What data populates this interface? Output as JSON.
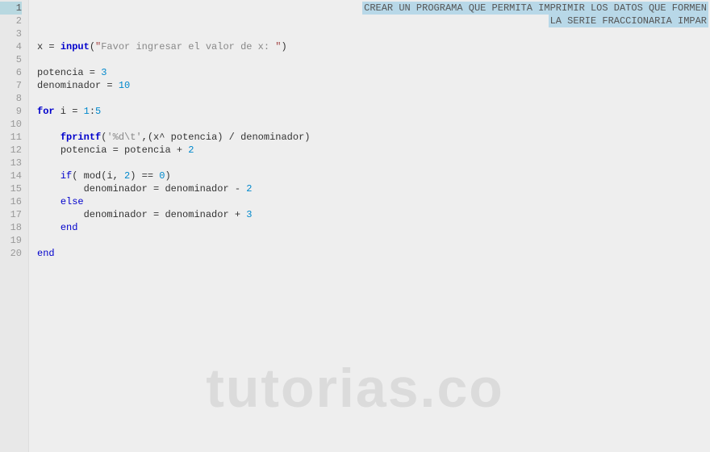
{
  "gutter": {
    "lines": [
      "1",
      "2",
      "3",
      "4",
      "5",
      "6",
      "7",
      "8",
      "9",
      "10",
      "11",
      "12",
      "13",
      "14",
      "15",
      "16",
      "17",
      "18",
      "19",
      "20"
    ],
    "highlighted": 1
  },
  "comment": {
    "line1": "CREAR UN PROGRAMA QUE PERMITA IMPRIMIR LOS DATOS QUE FORMEN",
    "line2": "LA SERIE FRACCIONARIA IMPAR"
  },
  "code": {
    "l4": {
      "var_x": "x",
      "eq": " = ",
      "input": "input",
      "open": "(",
      "q1": "\"",
      "str": "Favor ingresar el valor de x: ",
      "q2": "\"",
      "close": ")"
    },
    "l6": {
      "var": "potencia",
      "eq": " = ",
      "val": "3"
    },
    "l7": {
      "var": "denominador",
      "eq": " = ",
      "val": "10"
    },
    "l9": {
      "for": "for",
      "i": " i",
      "eq": " = ",
      "r1": "1",
      "colon": ":",
      "r2": "5"
    },
    "l11": {
      "indent": "    ",
      "fprintf": "fprintf",
      "open": "(",
      "fmt": "'%d\\t'",
      "rest": ",(x^ potencia) / denominador)"
    },
    "l12": {
      "indent": "    ",
      "lhs": "potencia",
      "eq": " = ",
      "rhs": "potencia",
      "op": " + ",
      "val": "2"
    },
    "l14": {
      "indent": "    ",
      "if": "if",
      "open": "( ",
      "mod": "mod",
      "args_open": "(",
      "arg1": "i",
      "comma": ", ",
      "arg2": "2",
      "args_close": ")",
      "eqeq": " == ",
      "zero": "0",
      "close": ")"
    },
    "l15": {
      "indent": "        ",
      "lhs": "denominador",
      "eq": " = ",
      "rhs": "denominador",
      "op": " - ",
      "val": "2"
    },
    "l16": {
      "indent": "    ",
      "else": "else"
    },
    "l17": {
      "indent": "        ",
      "lhs": "denominador",
      "eq": " = ",
      "rhs": "denominador",
      "op": " + ",
      "val": "3"
    },
    "l18": {
      "indent": "    ",
      "end": "end"
    },
    "l20": {
      "end": "end"
    }
  },
  "watermark": "tutorias.co"
}
